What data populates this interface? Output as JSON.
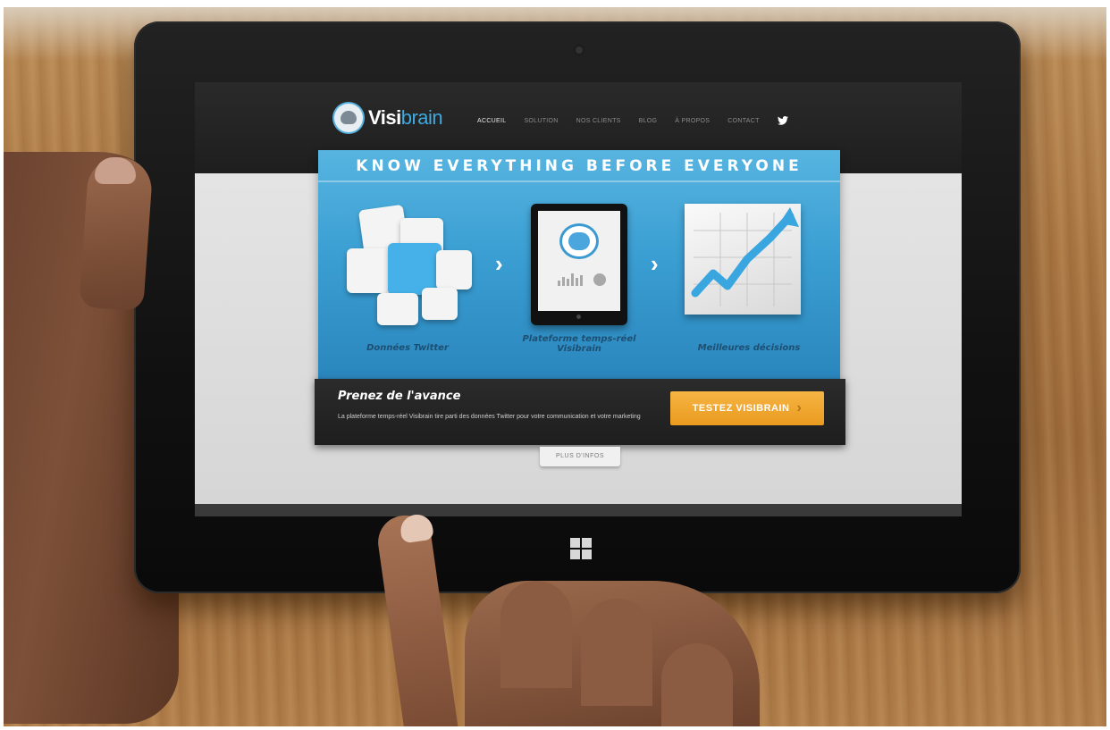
{
  "site": {
    "logo_part1": "Visi",
    "logo_part2": "brain",
    "nav": [
      "ACCUEIL",
      "SOLUTION",
      "NOS CLIENTS",
      "BLOG",
      "À PROPOS",
      "CONTACT"
    ],
    "nav_active_index": 0,
    "twitter_icon": "twitter-icon"
  },
  "hero": {
    "title": "KNOW EVERYTHING BEFORE EVERYONE",
    "step1_label": "Données Twitter",
    "step2_label_line1": "Plateforme temps-réel",
    "step2_label_line2": "Visibrain",
    "step3_label": "Meilleures décisions"
  },
  "cta": {
    "heading": "Prenez de l'avance",
    "text": "La plateforme temps-réel Visibrain tire parti des données Twitter pour votre communication et votre marketing",
    "button_label": "TESTEZ VISIBRAIN",
    "button_arrow": "›",
    "more_label": "PLUS D'INFOS"
  },
  "colors": {
    "accent_blue": "#3fa9e0",
    "cta_orange": "#e99b1f",
    "header_dark": "#1e1e1e"
  }
}
